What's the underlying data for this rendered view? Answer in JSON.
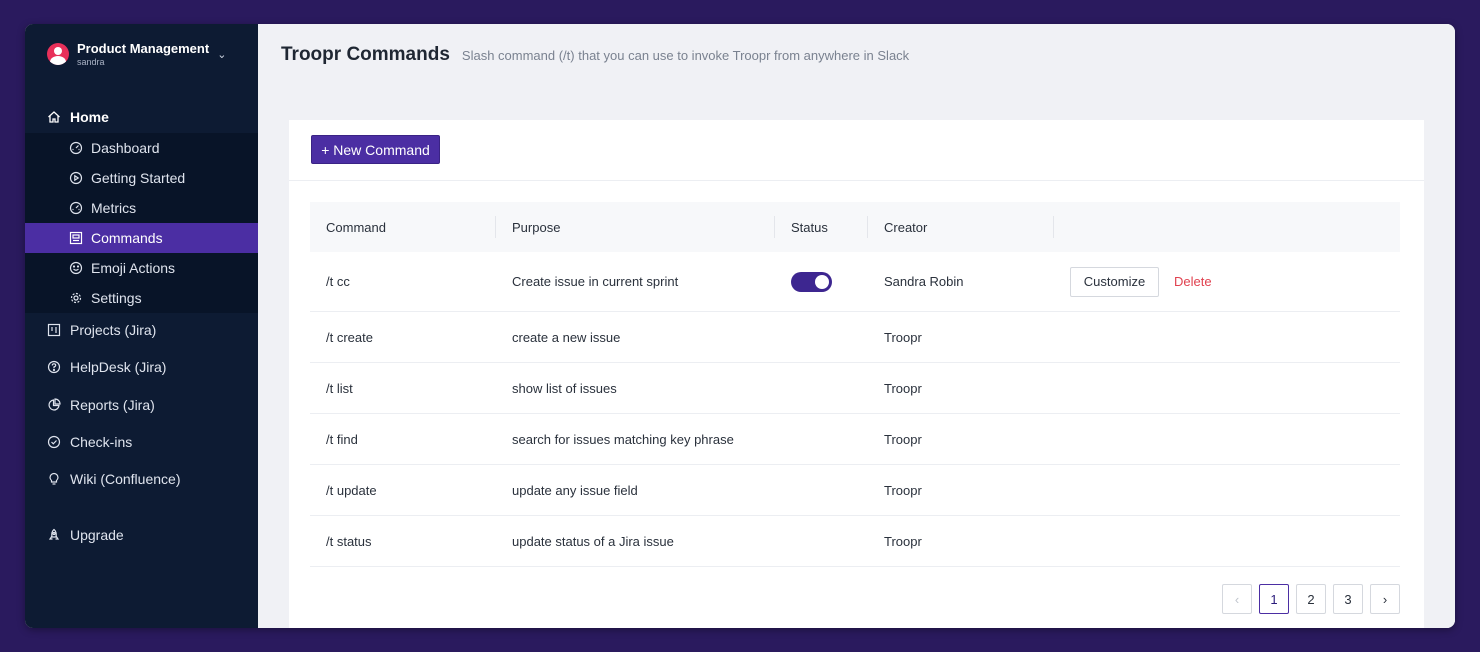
{
  "workspace": {
    "name": "Product Management",
    "user": "sandra"
  },
  "sidebar": {
    "home": {
      "label": "Home",
      "icon": "home-icon"
    },
    "sub_items": [
      {
        "label": "Dashboard",
        "icon": "gauge-icon"
      },
      {
        "label": "Getting Started",
        "icon": "play-circle-icon"
      },
      {
        "label": "Metrics",
        "icon": "gauge-icon"
      },
      {
        "label": "Commands",
        "icon": "command-icon",
        "active": true
      },
      {
        "label": "Emoji Actions",
        "icon": "smile-icon"
      },
      {
        "label": "Settings",
        "icon": "gear-icon"
      }
    ],
    "items": [
      {
        "label": "Projects (Jira)",
        "icon": "board-icon"
      },
      {
        "label": "HelpDesk (Jira)",
        "icon": "help-circle-icon"
      },
      {
        "label": "Reports (Jira)",
        "icon": "pie-chart-icon"
      },
      {
        "label": "Check-ins",
        "icon": "check-circle-icon"
      },
      {
        "label": "Wiki (Confluence)",
        "icon": "lightbulb-icon"
      },
      {
        "label": "Upgrade",
        "icon": "rocket-icon"
      }
    ]
  },
  "header": {
    "title": "Troopr Commands",
    "subtitle": "Slash command (/t) that you can use to invoke Troopr from anywhere in Slack"
  },
  "toolbar": {
    "new_command_label": "+ New Command"
  },
  "table": {
    "columns": [
      "Command",
      "Purpose",
      "Status",
      "Creator",
      ""
    ],
    "rows": [
      {
        "command": "/t cc",
        "purpose": "Create issue in current sprint",
        "status_on": true,
        "creator": "Sandra Robin",
        "customize": "Customize",
        "delete": "Delete"
      },
      {
        "command": "/t create",
        "purpose": "create a new issue",
        "creator": "Troopr"
      },
      {
        "command": "/t list",
        "purpose": "show list of issues",
        "creator": "Troopr"
      },
      {
        "command": "/t find",
        "purpose": "search for issues matching key phrase",
        "creator": "Troopr"
      },
      {
        "command": "/t update",
        "purpose": "update any issue field",
        "creator": "Troopr"
      },
      {
        "command": "/t status",
        "purpose": "update status of a Jira issue",
        "creator": "Troopr"
      }
    ]
  },
  "pagination": {
    "prev": "‹",
    "pages": [
      "1",
      "2",
      "3"
    ],
    "current": "1",
    "next": "›"
  },
  "colors": {
    "sidebar_bg": "#0d1b33",
    "accent": "#4b2ea3",
    "danger": "#e0414f",
    "frame": "#2a1a5e"
  }
}
